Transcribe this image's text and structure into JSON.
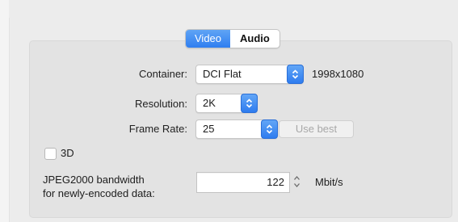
{
  "tabs": [
    {
      "label": "Video",
      "active": true
    },
    {
      "label": "Audio",
      "active": false
    }
  ],
  "fields": {
    "container_label": "Container:",
    "container_value": "DCI Flat",
    "container_dims": "1998x1080",
    "resolution_label": "Resolution:",
    "resolution_value": "2K",
    "frame_rate_label": "Frame Rate:",
    "frame_rate_value": "25",
    "use_best_label": "Use best",
    "threed_label": "3D",
    "bandwidth_label_line1": "JPEG2000 bandwidth",
    "bandwidth_label_line2": "for newly-encoded data:",
    "bandwidth_value": "122",
    "bandwidth_unit": "Mbit/s"
  },
  "icons": {
    "select_arrow": "chevron-updown-icon",
    "stepper": "stepper-icon"
  },
  "colors": {
    "accent": "#2f7ef0",
    "panel": "#e3e3e3"
  }
}
